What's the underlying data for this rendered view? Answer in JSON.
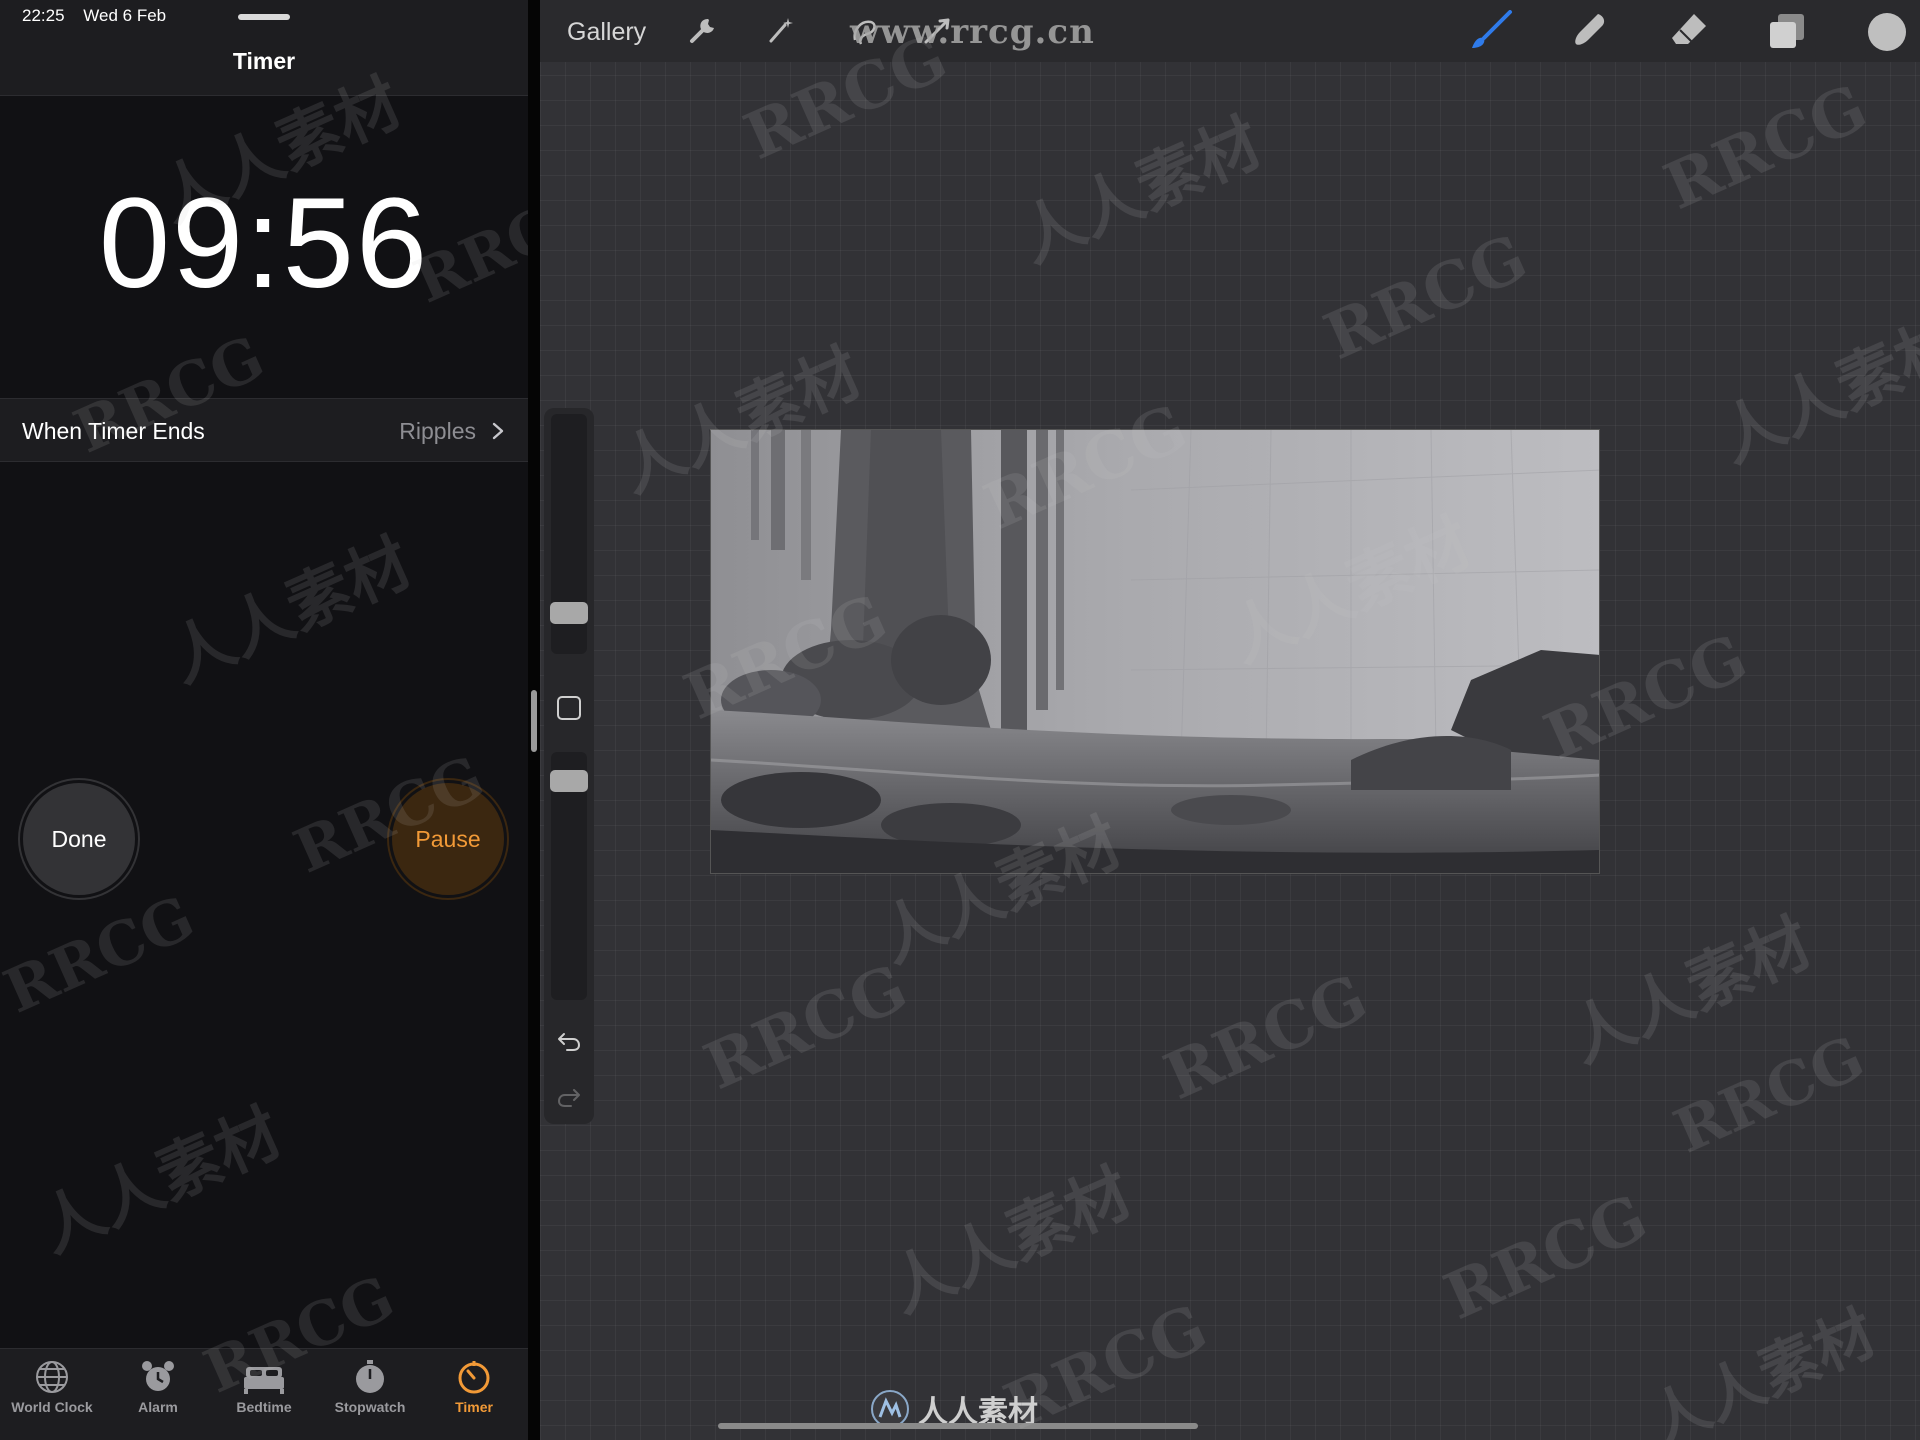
{
  "status_bar": {
    "time": "22:25",
    "date": "Wed 6 Feb"
  },
  "clock_app": {
    "title": "Timer",
    "countdown": "09:56",
    "when_timer_ends": {
      "label": "When Timer Ends",
      "value": "Ripples"
    },
    "buttons": {
      "done": "Done",
      "pause": "Pause"
    },
    "tabs": [
      {
        "label": "World Clock",
        "icon": "globe-icon",
        "active": false
      },
      {
        "label": "Alarm",
        "icon": "alarm-clock-icon",
        "active": false
      },
      {
        "label": "Bedtime",
        "icon": "bed-icon",
        "active": false
      },
      {
        "label": "Stopwatch",
        "icon": "stopwatch-icon",
        "active": false
      },
      {
        "label": "Timer",
        "icon": "timer-icon",
        "active": true
      }
    ],
    "accent_color": "#f29a37"
  },
  "procreate": {
    "gallery_label": "Gallery",
    "toolbar_icons": [
      "wrench-icon",
      "magic-wand-icon",
      "selection-icon",
      "transform-icon",
      "brush-icon",
      "smudge-icon",
      "eraser-icon",
      "layers-icon",
      "color-icon"
    ],
    "active_tool_color": "#2f7bea",
    "current_color": "#bfbfbf",
    "watermark_url": "www.rrcg.cn"
  },
  "watermarks": {
    "brand": "RRCG",
    "chinese": "人人素材"
  }
}
